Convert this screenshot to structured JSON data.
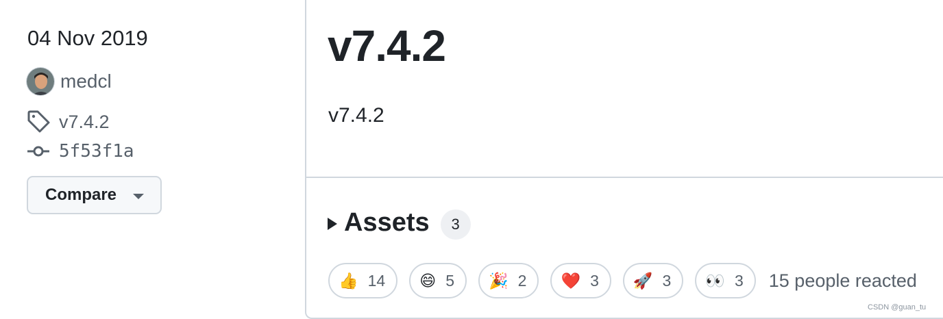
{
  "sidebar": {
    "date": "04 Nov 2019",
    "author": "medcl",
    "tag": "v7.4.2",
    "commit": "5f53f1a",
    "compare_label": "Compare"
  },
  "release": {
    "title": "v7.4.2",
    "body": "v7.4.2",
    "assets_label": "Assets",
    "assets_count": "3"
  },
  "reactions": [
    {
      "emoji": "👍",
      "icon": "thumbs-up-icon",
      "count": "14"
    },
    {
      "emoji": "😄",
      "icon": "laugh-icon",
      "count": "5"
    },
    {
      "emoji": "🎉",
      "icon": "hooray-icon",
      "count": "2"
    },
    {
      "emoji": "❤️",
      "icon": "heart-icon",
      "count": "3"
    },
    {
      "emoji": "🚀",
      "icon": "rocket-icon",
      "count": "3"
    },
    {
      "emoji": "👀",
      "icon": "eyes-icon",
      "count": "3"
    }
  ],
  "reacted_text": "15 people reacted",
  "watermark": "CSDN @guan_tu",
  "colors": {
    "text": "#1f2328",
    "muted": "#57606a",
    "border": "#d0d7de",
    "button_bg": "#f6f8fa"
  }
}
